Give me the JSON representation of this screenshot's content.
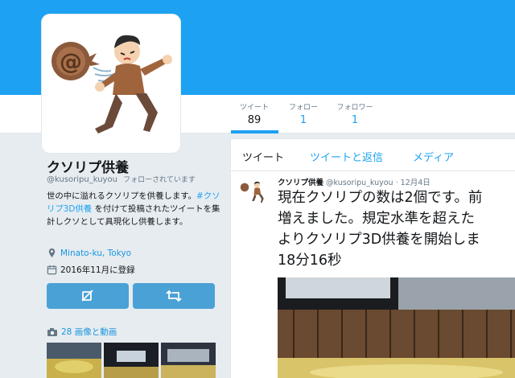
{
  "profile": {
    "name": "クソリプ供養",
    "handle": "@kusoripu_kuyou",
    "follows_you": "フォローされています",
    "bio_prefix": "世の中に溢れるクソリプを供養します。",
    "bio_hashtag": "#クソリプ3D供養",
    "bio_suffix": "を付けて投稿されたツイートを集計しクソとして具現化し供養します。",
    "location": "Minato-ku, Tokyo",
    "joined": "2016年11月に登録",
    "media_count": "28 画像と動画"
  },
  "stats": [
    {
      "label": "ツイート",
      "value": "89"
    },
    {
      "label": "フォロー",
      "value": "1"
    },
    {
      "label": "フォロワー",
      "value": "1"
    }
  ],
  "tabs": [
    "ツイート",
    "ツイートと返信",
    "メディア"
  ],
  "tweet": {
    "name": "クソリプ供養",
    "handle": "@kusoripu_kuyou",
    "date": "· 12月4日",
    "lines": [
      "現在クソリプの数は2個です。前",
      "増えました。規定水準を超えた",
      "よりクソリプ3D供養を開始しま",
      "18分16秒"
    ]
  },
  "colors": {
    "accent": "#1da1f2",
    "banner": "#1da1f2",
    "button": "#4aa1d6",
    "background": "#e6ecf0"
  },
  "icons": [
    "location-pin-icon",
    "calendar-icon",
    "mute-icon",
    "retweet-icon",
    "camera-icon"
  ]
}
